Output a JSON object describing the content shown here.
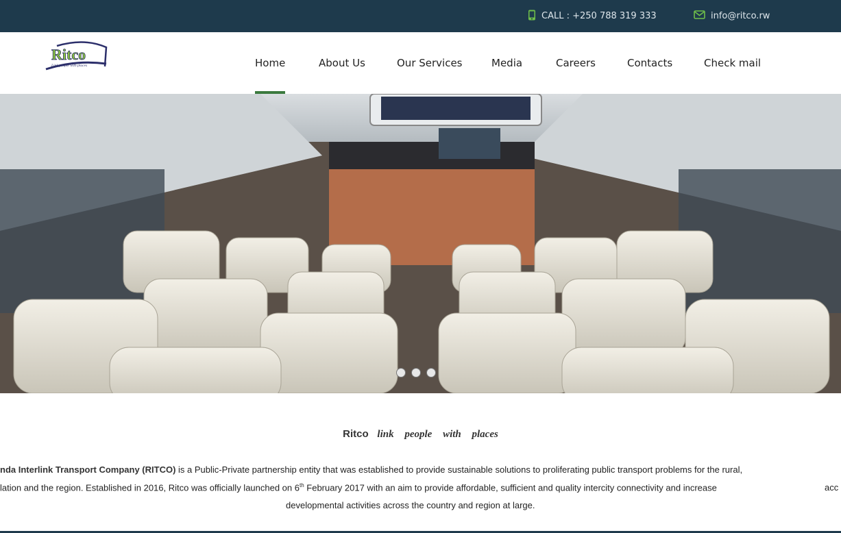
{
  "topbar": {
    "phone_text": "CALL : +250 788 319 333",
    "email_text": "info@ritco.rw",
    "icons": [
      "phone-icon",
      "mail-icon"
    ],
    "accent_color": "#3b9c3b"
  },
  "logo": {
    "text": "Ritco",
    "subtext": "Link people with places"
  },
  "nav": {
    "items": [
      "Home",
      "About Us",
      "Our Services",
      "Media",
      "Careers",
      "Contacts",
      "Check mail"
    ],
    "active": "Home"
  },
  "slider": {
    "slide_count": 3
  },
  "intro": {
    "brand": "Ritco",
    "motto": "link people with places",
    "line1_bold": "nda Interlink Transport Company (RITCO)",
    "line1_rest": " is a Public-Private partnership entity that was established to provide sustainable solutions to proliferating public transport problems for the rural,",
    "line2_a": "lation and the region. Established in 2016, Ritco was officially launched on 6",
    "line2_sup": "th",
    "line2_b": " February 2017 with an aim to provide affordable, sufficient and quality intercity connectivity and increase",
    "line2_tail": "acc",
    "line3": "developmental activities across the country and region at large."
  }
}
